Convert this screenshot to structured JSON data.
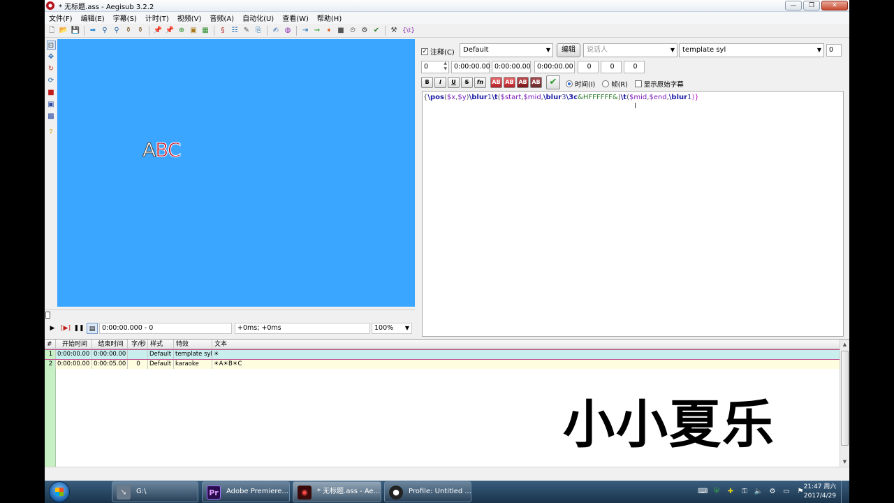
{
  "window": {
    "title": "* 无标题.ass - Aegisub 3.2.2",
    "minimize": "—",
    "restore": "❐",
    "close": "✕"
  },
  "menu": [
    "文件(F)",
    "编辑(E)",
    "字幕(S)",
    "计时(T)",
    "视频(V)",
    "音频(A)",
    "自动化(U)",
    "查看(W)",
    "帮助(H)"
  ],
  "toolbar_tail_label": "{\\t}",
  "video": {
    "text_white": "A",
    "text_red": "BC",
    "bg_color": "#3aa6ff",
    "time": "0:00:00.000 - 0",
    "offset": "+0ms; +0ms",
    "zoom": "100%"
  },
  "edit": {
    "comment_label": "注释(C)",
    "comment_checked": true,
    "style": "Default",
    "edit_button": "编辑",
    "actor_placeholder": "说话人",
    "effect": "template syl",
    "layer": "0",
    "row2": {
      "layer": "0",
      "start": "0:00:00.00",
      "end": "0:00:00.00",
      "duration": "0:00:00.00",
      "margin_l": "0",
      "margin_r": "0",
      "margin_v": "0"
    },
    "format_buttons": [
      "B",
      "I",
      "U",
      "S",
      "fn",
      "AB",
      "AB",
      "AB",
      "AB"
    ],
    "radio_time": "时间(I)",
    "radio_frame": "帧(R)",
    "show_original": "显示原始字幕"
  },
  "editor_tokens": [
    {
      "t": "{",
      "c": "tk-k"
    },
    {
      "t": "\\pos",
      "c": "tk-b"
    },
    {
      "t": "(",
      "c": "tk-k"
    },
    {
      "t": "$x",
      "c": "tk-c"
    },
    {
      "t": ",",
      "c": "tk-k"
    },
    {
      "t": "$y",
      "c": "tk-c"
    },
    {
      "t": ")",
      "c": "tk-k"
    },
    {
      "t": "\\blur",
      "c": "tk-b"
    },
    {
      "t": "1",
      "c": "tk-n"
    },
    {
      "t": "\\t",
      "c": "tk-b"
    },
    {
      "t": "(",
      "c": "tk-k"
    },
    {
      "t": "$start",
      "c": "tk-c"
    },
    {
      "t": ",",
      "c": "tk-k"
    },
    {
      "t": "$mid",
      "c": "tk-c"
    },
    {
      "t": ",",
      "c": "tk-k"
    },
    {
      "t": "\\blur",
      "c": "tk-b"
    },
    {
      "t": "3",
      "c": "tk-n"
    },
    {
      "t": "\\3c",
      "c": "tk-b"
    },
    {
      "t": "&HFFFFFF&",
      "c": "tk-g"
    },
    {
      "t": ")",
      "c": "tk-k"
    },
    {
      "t": "\\t",
      "c": "tk-b"
    },
    {
      "t": "(",
      "c": "tk-k"
    },
    {
      "t": "$mid",
      "c": "tk-c"
    },
    {
      "t": ",",
      "c": "tk-k"
    },
    {
      "t": "$end",
      "c": "tk-c"
    },
    {
      "t": ",",
      "c": "tk-k"
    },
    {
      "t": "\\blur",
      "c": "tk-b"
    },
    {
      "t": "1",
      "c": "tk-n"
    },
    {
      "t": ")}",
      "c": "tk-p"
    }
  ],
  "grid": {
    "headers": [
      "#",
      "开始时间",
      "结束时间",
      "字/秒",
      "样式",
      "特效",
      "文本"
    ],
    "rows": [
      [
        "1",
        "0:00:00.00",
        "0:00:00.00",
        "",
        "Default",
        "template syl",
        "☀"
      ],
      [
        "2",
        "0:00:00.00",
        "0:00:05.00",
        "0",
        "Default",
        "karaoke",
        "☀A☀B☀C"
      ]
    ]
  },
  "watermark": "小小夏乐",
  "taskbar": {
    "tasks": [
      {
        "label": "G:\\",
        "icon": "➘",
        "icon_bg": "#6b7b8c"
      },
      {
        "label": "Adobe Premiere...",
        "icon": "Pr",
        "icon_bg": "#2a0b4e"
      },
      {
        "label": "* 无标题.ass - Ae...",
        "icon": "◉",
        "icon_bg": "#3a0a0a"
      },
      {
        "label": "Profile: Untitled ...",
        "icon": "●",
        "icon_bg": "#222"
      }
    ],
    "time": "21:47 周六",
    "date": "2017/4/29"
  }
}
